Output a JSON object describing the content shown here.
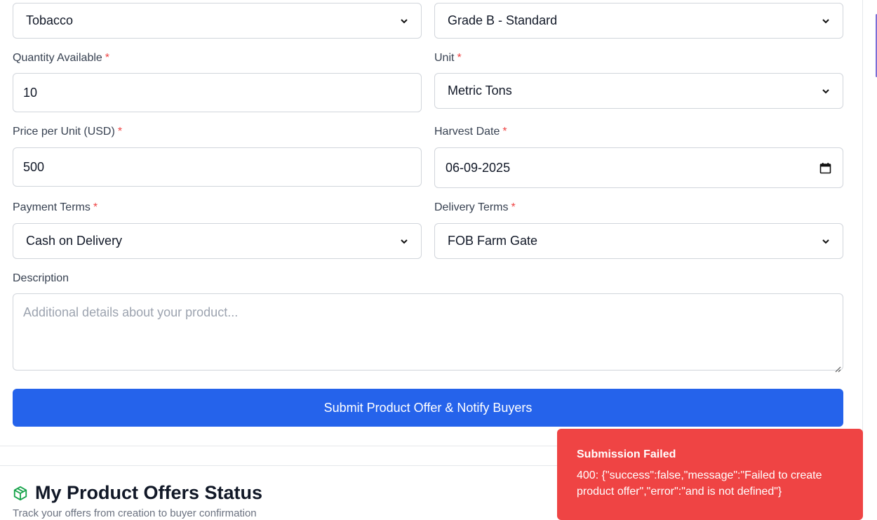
{
  "form": {
    "product_select": "Tobacco",
    "grade_select": "Grade B - Standard",
    "quantity_label": "Quantity Available",
    "quantity_value": "10",
    "unit_label": "Unit",
    "unit_select": "Metric Tons",
    "price_label": "Price per Unit (USD)",
    "price_value": "500",
    "harvest_label": "Harvest Date",
    "harvest_value": "06-09-2025",
    "payment_label": "Payment Terms",
    "payment_select": "Cash on Delivery",
    "delivery_label": "Delivery Terms",
    "delivery_select": "FOB Farm Gate",
    "description_label": "Description",
    "description_placeholder": "Additional details about your product...",
    "required_marker": "*",
    "submit_label": "Submit Product Offer & Notify Buyers"
  },
  "offers_section": {
    "title": "My Product Offers Status",
    "icon": "package-icon",
    "subtitle_partial": "Track your offers from creation to buyer confirmation"
  },
  "toast": {
    "title": "Submission Failed",
    "message": "400: {\"success\":false,\"message\":\"Failed to create product offer\",\"error\":\"and is not defined\"}"
  },
  "colors": {
    "primary": "#2563eb",
    "error": "#ef4444",
    "required": "#ef4444",
    "icon_green": "#16a34a"
  }
}
